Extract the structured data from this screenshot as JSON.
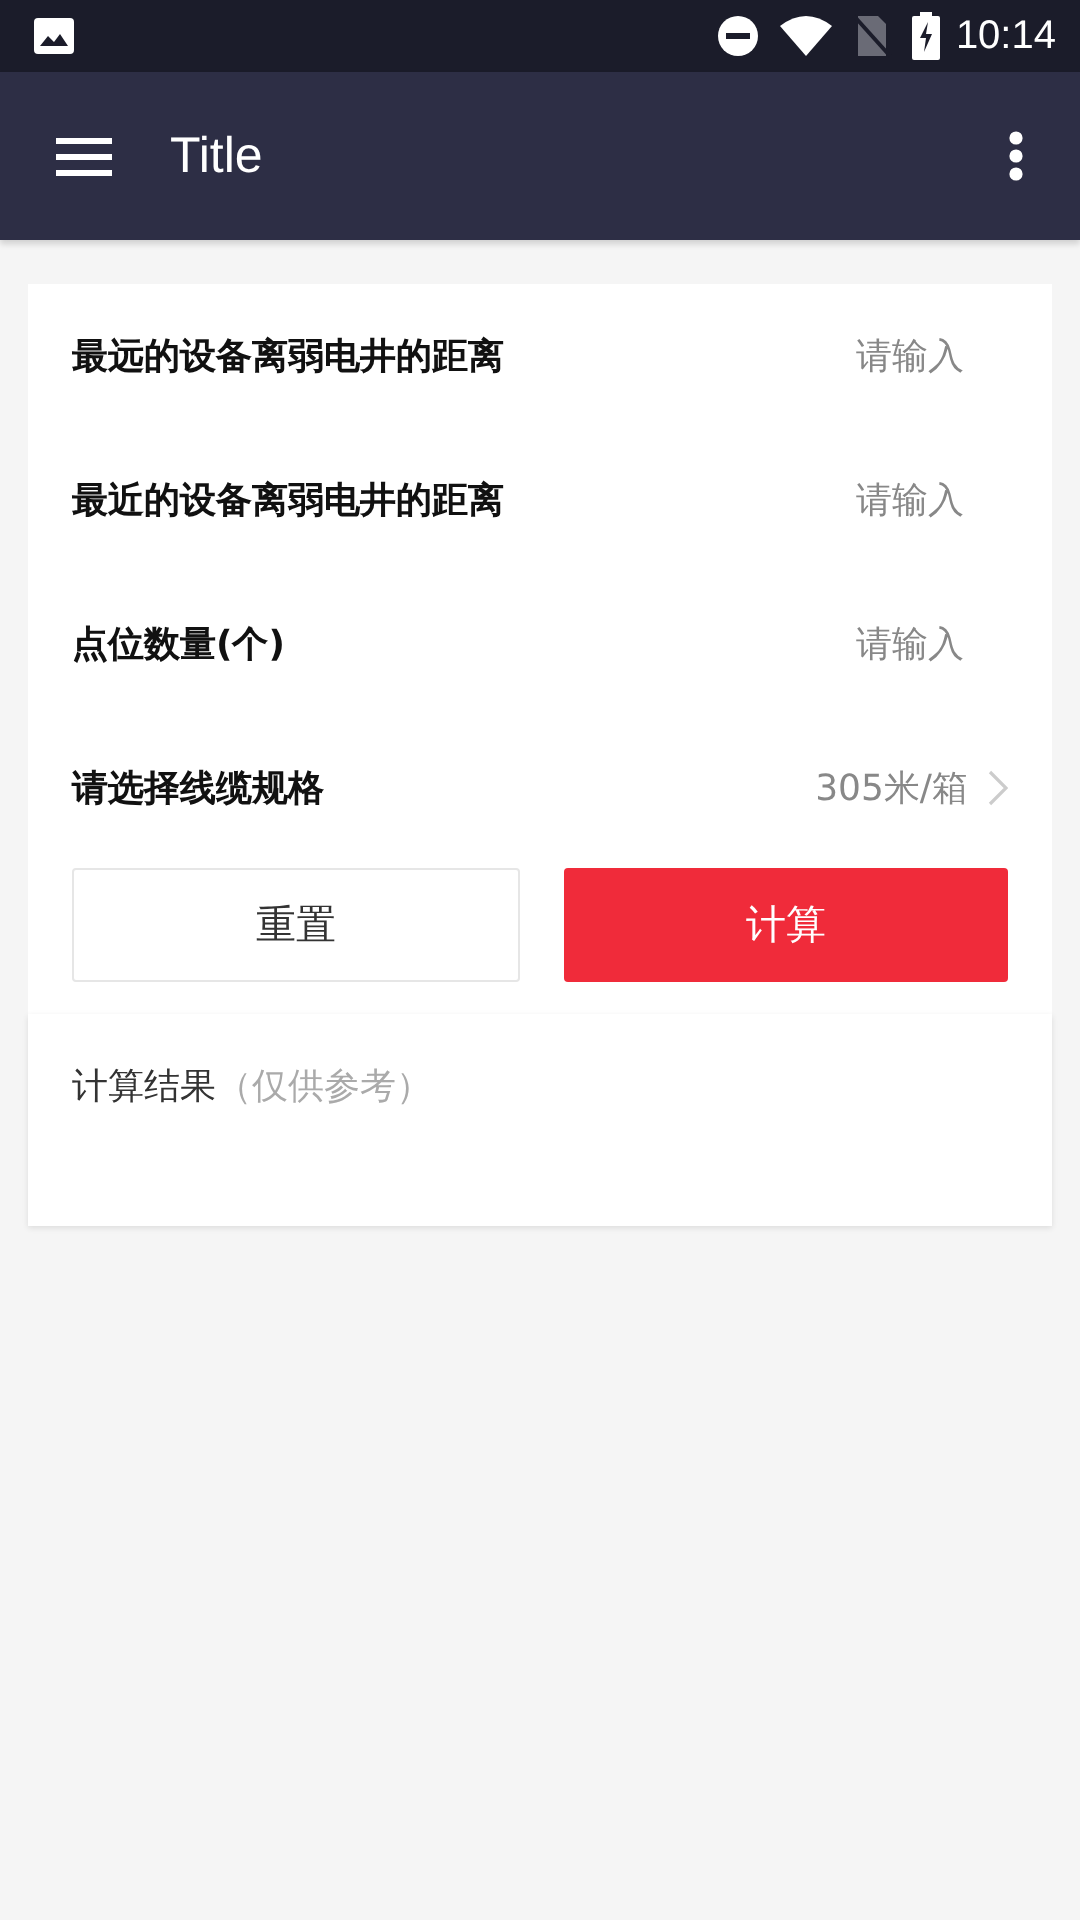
{
  "status_bar": {
    "time": "10:14"
  },
  "app_bar": {
    "title": "Title"
  },
  "form": {
    "rows": [
      {
        "kind": "input",
        "label": "最远的设备离弱电井的距离",
        "placeholder": "请输入"
      },
      {
        "kind": "input",
        "label": "最近的设备离弱电井的距离",
        "placeholder": "请输入"
      },
      {
        "kind": "input",
        "label": "点位数量(个)",
        "placeholder": "请输入"
      },
      {
        "kind": "select",
        "label": "请选择线缆规格",
        "value": "305米/箱"
      }
    ],
    "buttons": [
      {
        "kind": "secondary",
        "label": "重置"
      },
      {
        "kind": "primary",
        "label": "计算"
      }
    ]
  },
  "result": {
    "title": "计算结果",
    "note": "（仅供参考）"
  }
}
